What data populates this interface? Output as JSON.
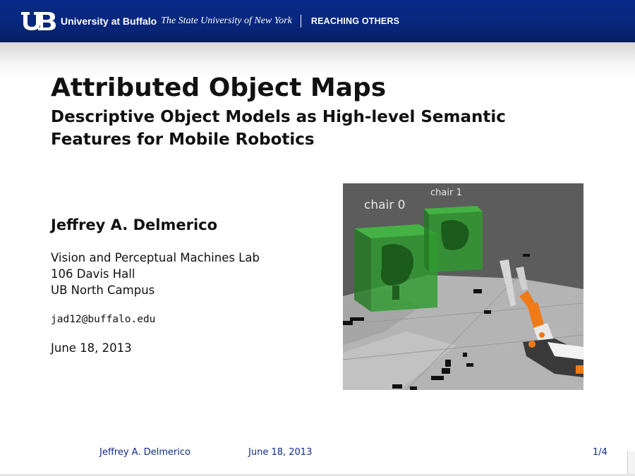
{
  "banner": {
    "logo_text": "UB",
    "university": "University at Buffalo",
    "subtitle": "The State University of New York",
    "tagline": "REACHING OTHERS"
  },
  "slide": {
    "title": "Attributed Object Maps",
    "subtitle": "Descriptive Object Models as High-level Semantic Features for Mobile Robotics",
    "author": "Jeffrey A. Delmerico",
    "affiliation": [
      "Vision and Perceptual Machines Lab",
      "106 Davis Hall",
      "UB North Campus"
    ],
    "email": "jad12@buffalo.edu",
    "date": "June 18, 2013"
  },
  "figure": {
    "labels": [
      "chair 0",
      "chair 1"
    ],
    "colors": {
      "background": "#5c5c5c",
      "floor": "#b4b4b4",
      "box": "#2e9b2e",
      "arm": "#f07a18"
    }
  },
  "footer": {
    "author": "Jeffrey A. Delmerico",
    "date": "June 18, 2013",
    "page": "1/4"
  }
}
